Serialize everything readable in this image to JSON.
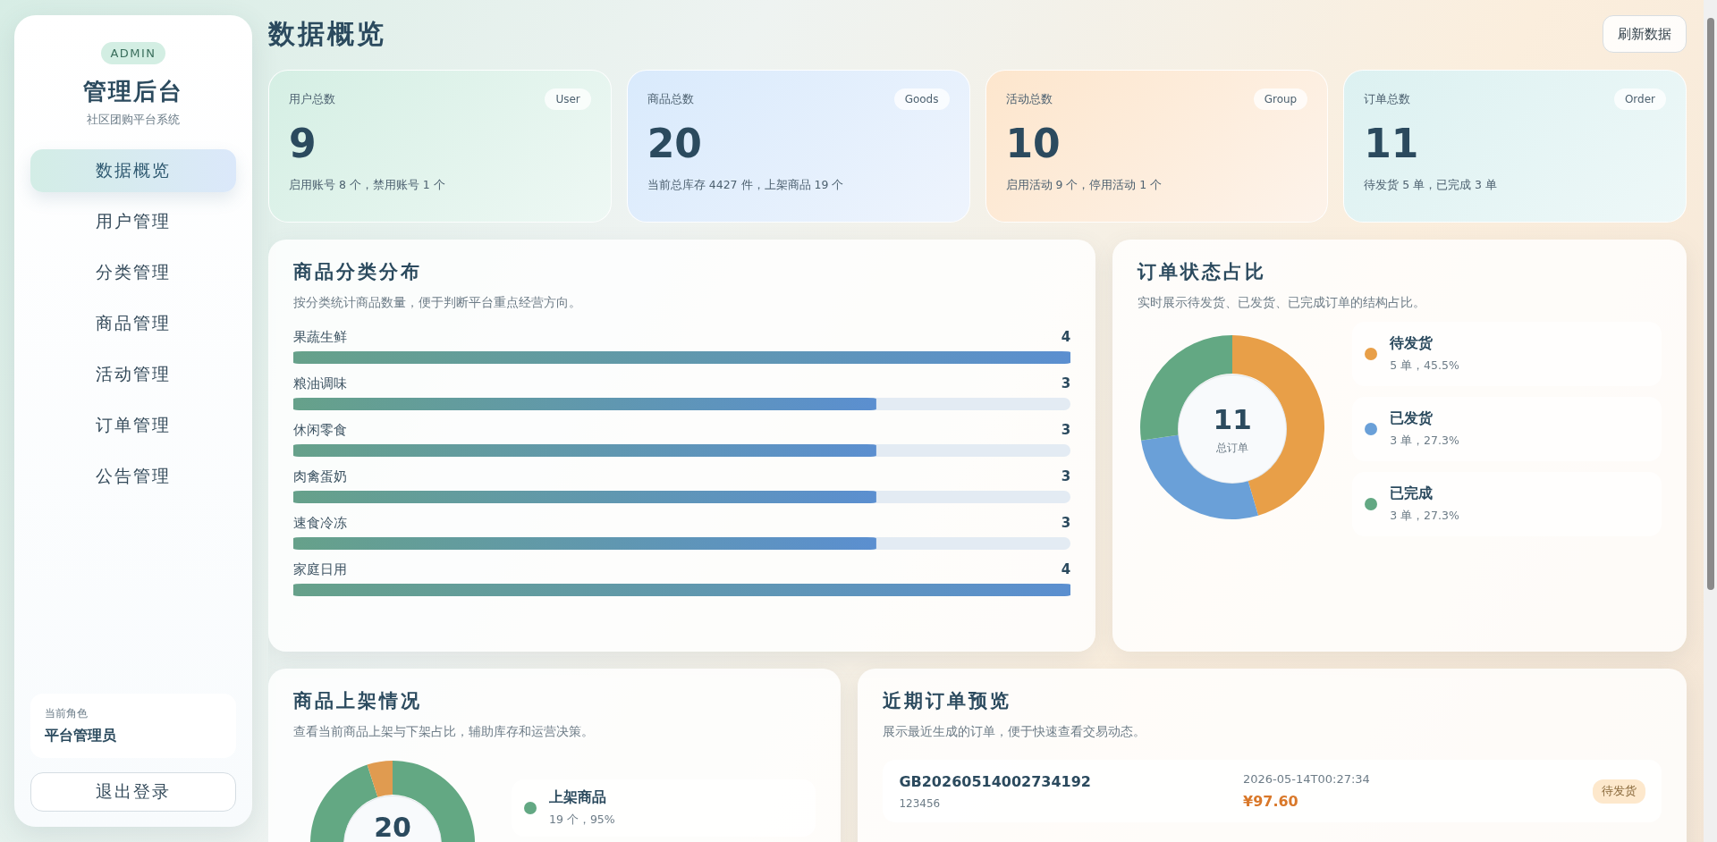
{
  "page_title": "数据概览",
  "refresh_button": "刷新数据",
  "sidebar": {
    "badge": "ADMIN",
    "title": "管理后台",
    "subtitle": "社区团购平台系统",
    "items": [
      {
        "label": "数据概览",
        "selected": true
      },
      {
        "label": "用户管理",
        "selected": false
      },
      {
        "label": "分类管理",
        "selected": false
      },
      {
        "label": "商品管理",
        "selected": false
      },
      {
        "label": "活动管理",
        "selected": false
      },
      {
        "label": "订单管理",
        "selected": false
      },
      {
        "label": "公告管理",
        "selected": false
      }
    ],
    "role": {
      "label": "当前角色",
      "value": "平台管理员"
    },
    "logout_button": "退出登录"
  },
  "stat_cards": [
    {
      "label": "用户总数",
      "tag": "User",
      "value": "9",
      "note": "启用账号 8 个，禁用账号 1 个"
    },
    {
      "label": "商品总数",
      "tag": "Goods",
      "value": "20",
      "note": "当前总库存 4427 件，上架商品 19 个"
    },
    {
      "label": "活动总数",
      "tag": "Group",
      "value": "10",
      "note": "启用活动 9 个，停用活动 1 个"
    },
    {
      "label": "订单总数",
      "tag": "Order",
      "value": "11",
      "note": "待发货 5 单，已完成 3 单"
    }
  ],
  "category_panel": {
    "title": "商品分类分布",
    "subtitle": "按分类统计商品数量，便于判断平台重点经营方向。",
    "chart_data": {
      "type": "bar",
      "orientation": "horizontal",
      "categories": [
        "果蔬生鲜",
        "粮油调味",
        "休闲零食",
        "肉禽蛋奶",
        "速食冷冻",
        "家庭日用"
      ],
      "values": [
        4,
        3,
        3,
        3,
        3,
        4
      ],
      "data_labels": true
    }
  },
  "order_status_panel": {
    "title": "订单状态占比",
    "subtitle": "实时展示待发货、已发货、已完成订单的结构占比。",
    "center_value": "11",
    "center_label": "总订单",
    "chart_data": {
      "type": "donut",
      "categories": [
        "待发货",
        "已发货",
        "已完成"
      ],
      "values": [
        45.5,
        27.3,
        27.3
      ]
    },
    "legend": [
      {
        "detail": "5 单，45.5%",
        "color": "#e89f48"
      },
      {
        "detail": "3 单，27.3%",
        "color": "#6aa0d8"
      },
      {
        "detail": "3 单，27.3%",
        "color": "#63a883"
      }
    ]
  },
  "shelf_panel": {
    "title": "商品上架情况",
    "subtitle": "查看当前商品上架与下架占比，辅助库存和运营决策。",
    "center_value": "20",
    "chart_data": {
      "type": "donut",
      "values": [
        95,
        5
      ]
    },
    "legend": [
      {
        "name": "上架商品",
        "detail": "19 个，95%",
        "color": "#63a883"
      }
    ]
  },
  "recent_orders_panel": {
    "title": "近期订单预览",
    "subtitle": "展示最近生成的订单，便于快速查看交易动态。",
    "orders": [
      {
        "order_no": "GB20260514002734192",
        "user": "123456",
        "time": "2026-05-14T00:27:34",
        "amount": "¥97.60",
        "status": "待发货"
      }
    ]
  }
}
